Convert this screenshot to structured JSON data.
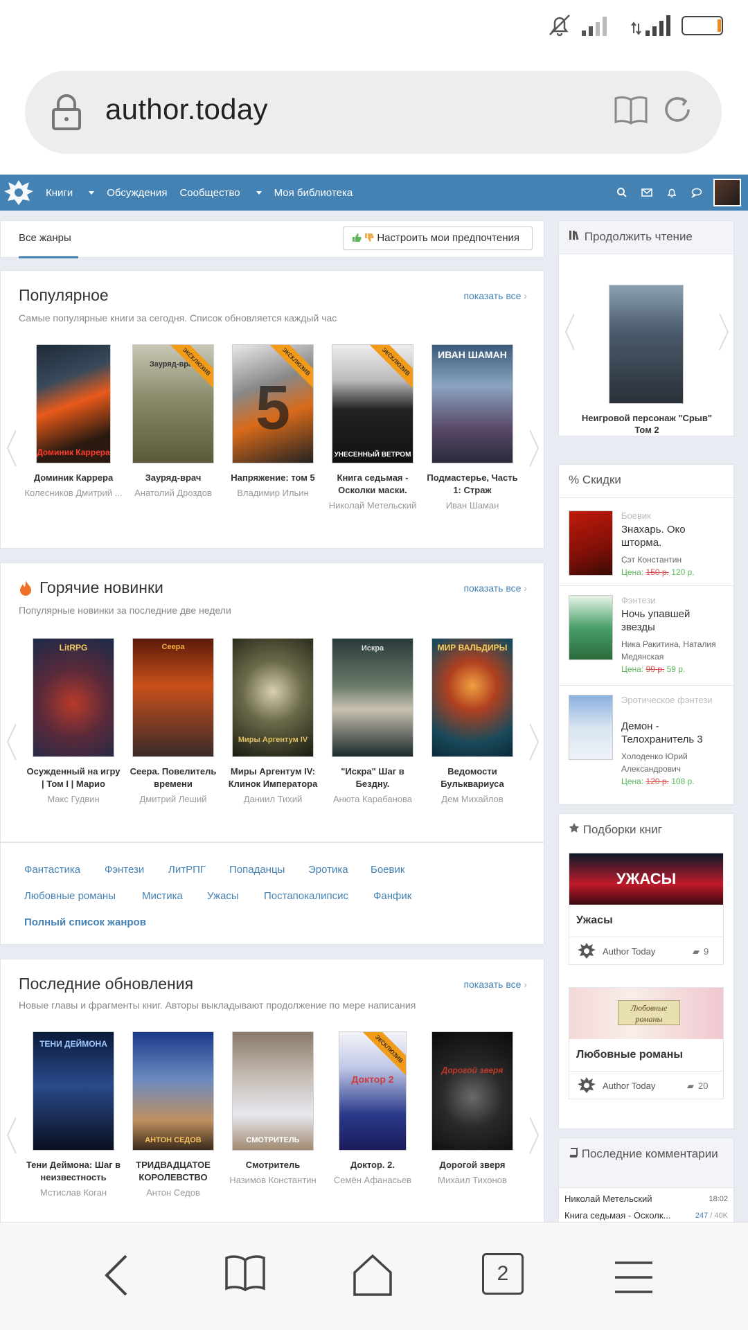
{
  "browser": {
    "url": "author.today",
    "tab_count": "2"
  },
  "nav": {
    "books": "Книги",
    "discussions": "Обсуждения",
    "community": "Сообщество",
    "library": "Моя библиотека"
  },
  "tabs": {
    "all_genres": "Все жанры",
    "preferences": "Настроить мои предпочтения"
  },
  "popular": {
    "title": "Популярное",
    "subtitle": "Самые популярные книги за сегодня. Список обновляется каждый час",
    "show_all": "показать все",
    "books": [
      {
        "title": "Доминик Каррера",
        "author": "Колесников Дмитрий ...",
        "cover_text": "Доминик Каррера",
        "exclusive": ""
      },
      {
        "title": "Зауряд-врач",
        "author": "Анатолий Дроздов",
        "cover_text": "Зауряд-врач",
        "exclusive": "эксклюзив"
      },
      {
        "title": "Напряжение: том 5",
        "author": "Владимир Ильин",
        "cover_text": "5",
        "exclusive": "эксклюзив"
      },
      {
        "title": "Книга седьмая - Осколки маски.",
        "author": "Николай Метельский",
        "cover_text": "УНЕСЕННЫЙ ВЕТРОМ",
        "exclusive": "эксклюзив"
      },
      {
        "title": "Подмастерье, Часть 1: Страж",
        "author": "Иван Шаман",
        "cover_text": "ИВАН ШАМАН",
        "exclusive": ""
      }
    ]
  },
  "hot": {
    "title": "Горячие новинки",
    "subtitle": "Популярные новинки за последние две недели",
    "show_all": "показать все",
    "books": [
      {
        "title": "Осужденный на игру | Том I | Марио",
        "author": "Макс Гудвин",
        "cover_text": "LitRPG"
      },
      {
        "title": "Сеера. Повелитель времени",
        "author": "Дмитрий Леший",
        "cover_text": "Сеера"
      },
      {
        "title": "Миры Аргентум IV: Клинок Императора",
        "author": "Даниил Тихий",
        "cover_text": "Миры Аргентум IV"
      },
      {
        "title": "\"Искра\" Шаг в Бездну.",
        "author": "Анюта Карабанова",
        "cover_text": "Искра"
      },
      {
        "title": "Ведомости Бульквариуса",
        "author": "Дем Михайлов",
        "cover_text": "МИР ВАЛЬДИРЫ"
      }
    ]
  },
  "genres": {
    "items": [
      "Фантастика",
      "Фэнтези",
      "ЛитРПГ",
      "Попаданцы",
      "Эротика",
      "Боевик",
      "Любовные романы",
      "Мистика",
      "Ужасы",
      "Постапокалипсис",
      "Фанфик"
    ],
    "full_list": "Полный список жанров"
  },
  "updates": {
    "title": "Последние обновления",
    "subtitle": "Новые главы и фрагменты книг. Авторы выкладывают продолжение по мере написания",
    "show_all": "показать все",
    "books": [
      {
        "title": "Тени Деймона: Шаг в неизвестность",
        "author": "Мстислав Коган",
        "cover_text": "ТЕНИ ДЕЙМОНА",
        "exclusive": ""
      },
      {
        "title": "ТРИДВАДЦАТОЕ КОРОЛЕВСТВО",
        "author": "Антон Седов",
        "cover_text": "АНТОН СЕДОВ",
        "exclusive": ""
      },
      {
        "title": "Смотритель",
        "author": "Назимов Константин",
        "cover_text": "СМОТРИТЕЛЬ",
        "exclusive": ""
      },
      {
        "title": "Доктор. 2.",
        "author": "Семён Афанасьев",
        "cover_text": "Доктор 2",
        "exclusive": "эксклюзив"
      },
      {
        "title": "Дорогой зверя",
        "author": "Михаил Тихонов",
        "cover_text": "Дорогой зверя",
        "exclusive": ""
      }
    ]
  },
  "sidebar": {
    "continue": {
      "title": "Продолжить чтение",
      "book_title": "Неигровой персонаж \"Срыв\" Том 2"
    },
    "discounts": {
      "title": "% Скидки",
      "items": [
        {
          "genre": "Боевик",
          "title": "Знахарь. Око шторма.",
          "author": "Сэт Константин",
          "price_label": "Цена:",
          "old_price": "150 р.",
          "new_price": "120 р."
        },
        {
          "genre": "Фэнтези",
          "title": "Ночь упавшей звезды",
          "author": "Ника Ракитина, Наталия Медянская",
          "price_label": "Цена:",
          "old_price": "99 р.",
          "new_price": "59 р."
        },
        {
          "genre": "Эротическое фэнтези",
          "title": "Демон - Телохранитель 3",
          "author": "Холоденко Юрий Александрович",
          "price_label": "Цена:",
          "old_price": "120 р.",
          "new_price": "108 р."
        }
      ]
    },
    "collections": {
      "title": "Подборки книг",
      "items": [
        {
          "banner": "УЖАСЫ",
          "title": "Ужасы",
          "owner": "Author Today",
          "count": "9"
        },
        {
          "banner": "Любовные романы",
          "title": "Любовные романы",
          "owner": "Author Today",
          "count": "20"
        }
      ]
    },
    "comments": {
      "title": "Последние комментарии",
      "user": "Николай Метельский",
      "time": "18:02",
      "book": "Книга седьмая - Осколк...",
      "count_a": "247",
      "count_b": "40K"
    }
  },
  "colors": {
    "nav_bg": "#4582b4",
    "link": "#4582b4",
    "exclusive": "#f29b18",
    "price_new": "#5cb85c",
    "price_old": "#d9534f"
  }
}
